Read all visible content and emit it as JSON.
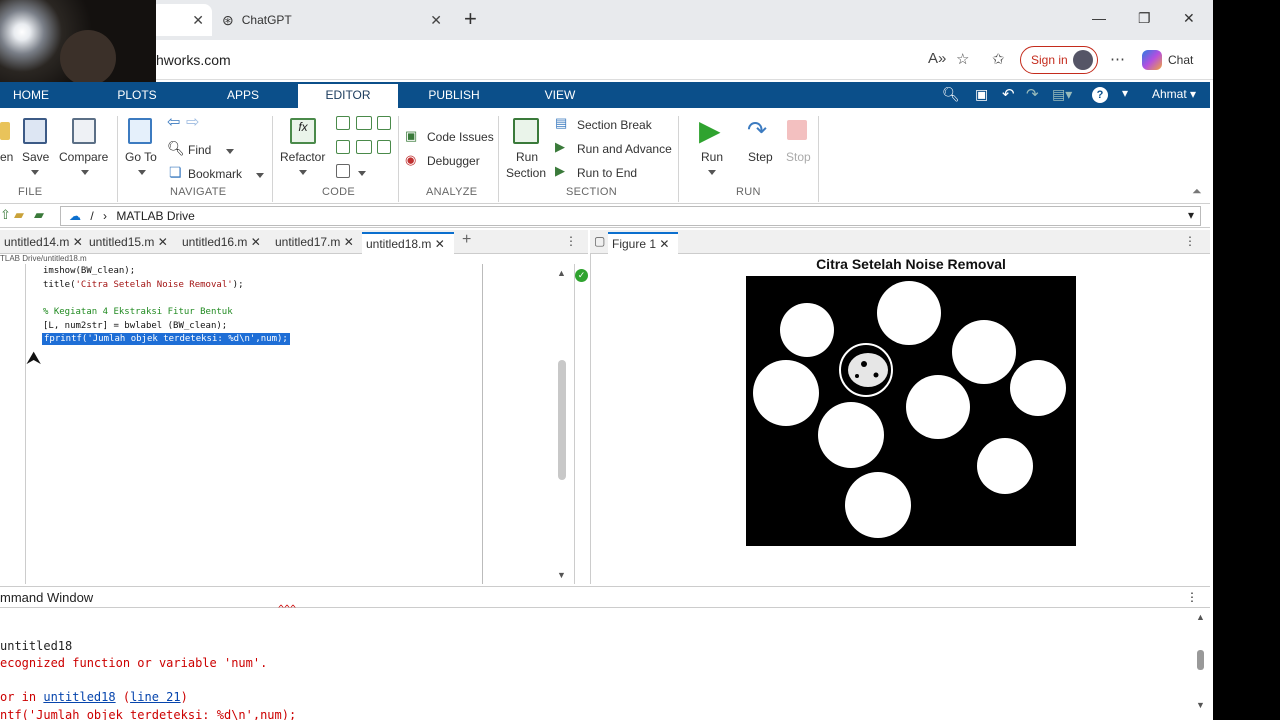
{
  "browser": {
    "tabs": [
      {
        "label": ""
      },
      {
        "label": "ChatGPT"
      }
    ],
    "url": "hworks.com",
    "sign_in": "Sign in",
    "chat": "Chat"
  },
  "matlab": {
    "tabs": [
      "HOME",
      "PLOTS",
      "APPS",
      "EDITOR",
      "PUBLISH",
      "VIEW"
    ],
    "active_tab": "EDITOR",
    "toolstrip": {
      "open_partial": "en",
      "save": "Save",
      "compare": "Compare",
      "go_to": "Go To",
      "find": "Find",
      "bookmark": "Bookmark",
      "refactor": "Refactor",
      "code_issues": "Code Issues",
      "debugger": "Debugger",
      "run_section": [
        "Run",
        "Section"
      ],
      "section_break": "Section Break",
      "run_and_advance": "Run and Advance",
      "run_to_end": "Run to End",
      "run": "Run",
      "step": "Step",
      "stop": "Stop",
      "groups": [
        "FILE",
        "NAVIGATE",
        "CODE",
        "ANALYZE",
        "SECTION",
        "RUN"
      ]
    },
    "user": "Ahmat",
    "path": {
      "sep": "/",
      "folder": "MATLAB Drive"
    },
    "editor": {
      "tabs": [
        "untitled14.m",
        "untitled15.m",
        "untitled16.m",
        "untitled17.m",
        "untitled18.m"
      ],
      "active_tab": "untitled18.m",
      "file_path": "TLAB Drive/untitled18.m",
      "lines": {
        "l1": "imshow(BW_clean);",
        "l2a": "title(",
        "l2s": "'Citra Setelah Noise Removal'",
        "l2b": ");",
        "l3": "% Kegiatan 4 Ekstraksi Fitur Bentuk",
        "l4": "[L, num2str] = bwlabel (BW_clean);",
        "l5": "fprintf('Jumlah objek terdeteksi: %d\\n',num);"
      }
    },
    "figure": {
      "tab": "Figure 1",
      "title": "Citra Setelah Noise Removal"
    },
    "command_window": {
      "title": "mmand Window",
      "lines": {
        "carets": "^^^",
        "c1": "untitled18",
        "c2": "ecognized function or variable 'num'.",
        "c3a": "or in ",
        "c3link": "untitled18",
        "c3b": " (",
        "c3link2": "line 21",
        "c3c": ")",
        "c4": "ntf('Jumlah objek terdeteksi: %d\\n',num);"
      }
    }
  }
}
